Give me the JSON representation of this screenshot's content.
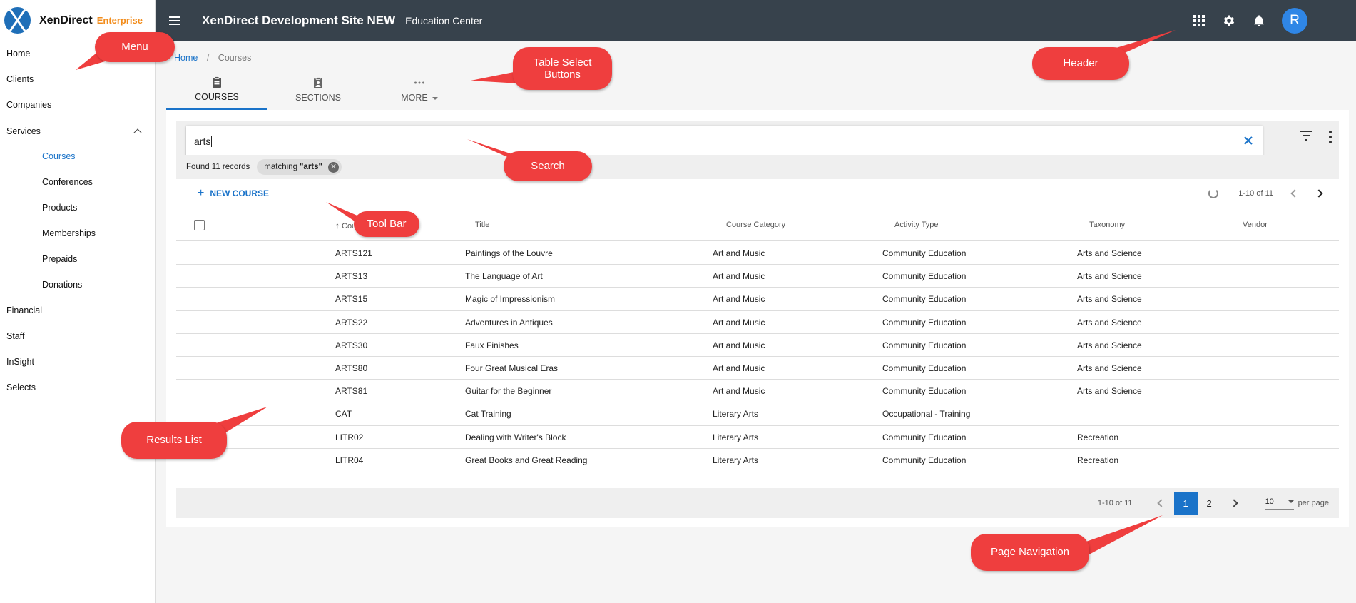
{
  "brand": {
    "name": "XenDirect",
    "edition": "Enterprise"
  },
  "sidebar": {
    "items": [
      {
        "label": "Home"
      },
      {
        "label": "Clients"
      },
      {
        "label": "Companies"
      },
      {
        "label": "Services"
      },
      {
        "label": "Courses"
      },
      {
        "label": "Conferences"
      },
      {
        "label": "Products"
      },
      {
        "label": "Memberships"
      },
      {
        "label": "Prepaids"
      },
      {
        "label": "Donations"
      },
      {
        "label": "Financial"
      },
      {
        "label": "Staff"
      },
      {
        "label": "InSight"
      },
      {
        "label": "Selects"
      }
    ]
  },
  "header": {
    "title": "XenDirect Development Site NEW",
    "subtitle": "Education Center",
    "avatar_initial": "R",
    "icons": [
      "apps-grid-icon",
      "gear-icon",
      "bell-icon"
    ]
  },
  "breadcrumb": {
    "home": "Home",
    "sep": "/",
    "current": "Courses"
  },
  "tabs": [
    {
      "label": "COURSES",
      "icon": "clipboard-icon"
    },
    {
      "label": "SECTIONS",
      "icon": "clipboard-person-icon"
    },
    {
      "label": "MORE",
      "icon": "more-dots-icon"
    }
  ],
  "search": {
    "value": "arts"
  },
  "results": {
    "found": "Found 11 records",
    "chip_prefix": "matching",
    "chip_term": "\"arts\""
  },
  "toolbar": {
    "new_label": "NEW COURSE",
    "range": "1-10 of 11"
  },
  "table": {
    "columns": [
      "Course ID",
      "Title",
      "Course Category",
      "Activity Type",
      "Taxonomy",
      "Vendor"
    ],
    "rows": [
      [
        "ARTS121",
        "Paintings of the Louvre",
        "Art and Music",
        "Community Education",
        "Arts and Science"
      ],
      [
        "ARTS13",
        "The Language of Art",
        "Art and Music",
        "Community Education",
        "Arts and Science"
      ],
      [
        "ARTS15",
        "Magic of Impressionism",
        "Art and Music",
        "Community Education",
        "Arts and Science"
      ],
      [
        "ARTS22",
        "Adventures in Antiques",
        "Art and Music",
        "Community Education",
        "Arts and Science"
      ],
      [
        "ARTS30",
        "Faux Finishes",
        "Art and Music",
        "Community Education",
        "Arts and Science"
      ],
      [
        "ARTS80",
        "Four Great Musical Eras",
        "Art and Music",
        "Community Education",
        "Arts and Science"
      ],
      [
        "ARTS81",
        "Guitar for the Beginner",
        "Art and Music",
        "Community Education",
        "Arts and Science"
      ],
      [
        "CAT",
        "Cat Training",
        "Literary Arts",
        "Occupational - Training",
        ""
      ],
      [
        "LITR02",
        "Dealing with Writer's Block",
        "Literary Arts",
        "Community Education",
        "Recreation"
      ],
      [
        "LITR04",
        "Great Books and Great Reading",
        "Literary Arts",
        "Community Education",
        "Recreation"
      ]
    ]
  },
  "pagination": {
    "range": "1-10 of 11",
    "pages": [
      "1",
      "2"
    ],
    "current_page": "1",
    "per_page_value": "10",
    "per_page_label": "per page"
  },
  "callouts": {
    "menu": "Menu",
    "header": "Header",
    "table_select": "Table Select Buttons",
    "search": "Search",
    "toolbar": "Tool Bar",
    "results_list": "Results List",
    "page_navigation": "Page Navigation"
  },
  "colors": {
    "header_bg": "#37424c",
    "accent": "#1a73c9",
    "brand_orange": "#f28c1b",
    "callout": "#ef3e3e",
    "avatar": "#2f86e6"
  }
}
